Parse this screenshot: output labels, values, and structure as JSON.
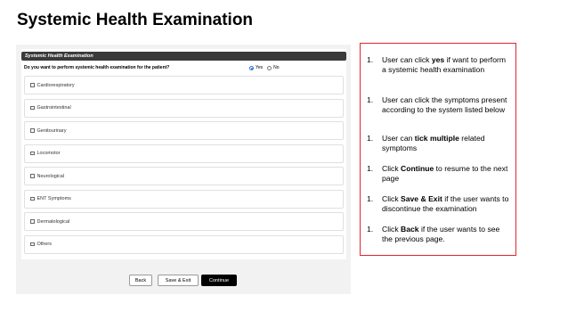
{
  "slide": {
    "title": "Systemic Health Examination"
  },
  "form": {
    "section_title": "Systemic Health Examination",
    "question": "Do you want to perform systemic health examination for the patient?",
    "radio_options": [
      {
        "label": "Yes",
        "selected": true
      },
      {
        "label": "No",
        "selected": false
      }
    ],
    "systems": [
      "Cardiorespiratory",
      "Gastrointestinal",
      "Genitourinary",
      "Locomotor",
      "Neurological",
      "ENT Symptoms",
      "Dermatological",
      "Others"
    ],
    "buttons": {
      "back": "Back",
      "save_exit": "Save & Exit",
      "continue": "Continue"
    }
  },
  "notes": [
    {
      "num": "1.",
      "pre": " User can click ",
      "bold": "yes",
      "post": " if want to perform a systemic health examination"
    },
    {
      "num": "1.",
      "pre": "User can click the symptoms present according to the system listed below",
      "bold": "",
      "post": ""
    },
    {
      "num": "1.",
      "pre": "User can ",
      "bold": "tick multiple",
      "post": " related symptoms"
    },
    {
      "num": "1.",
      "pre": "Click ",
      "bold": "Continue",
      "post": " to resume to the next page"
    },
    {
      "num": "1.",
      "pre": "Click ",
      "bold": "Save & Exit",
      "post": " if the user wants to discontinue the examination"
    },
    {
      "num": "1.",
      "pre": "Click ",
      "bold": "Back",
      "post": " if the user wants to see the previous page."
    }
  ],
  "colors": {
    "header_bg": "#3a3a3a",
    "accent_red": "#e0262c",
    "radio_blue": "#2f6fd6",
    "continue_bg": "#000000"
  }
}
